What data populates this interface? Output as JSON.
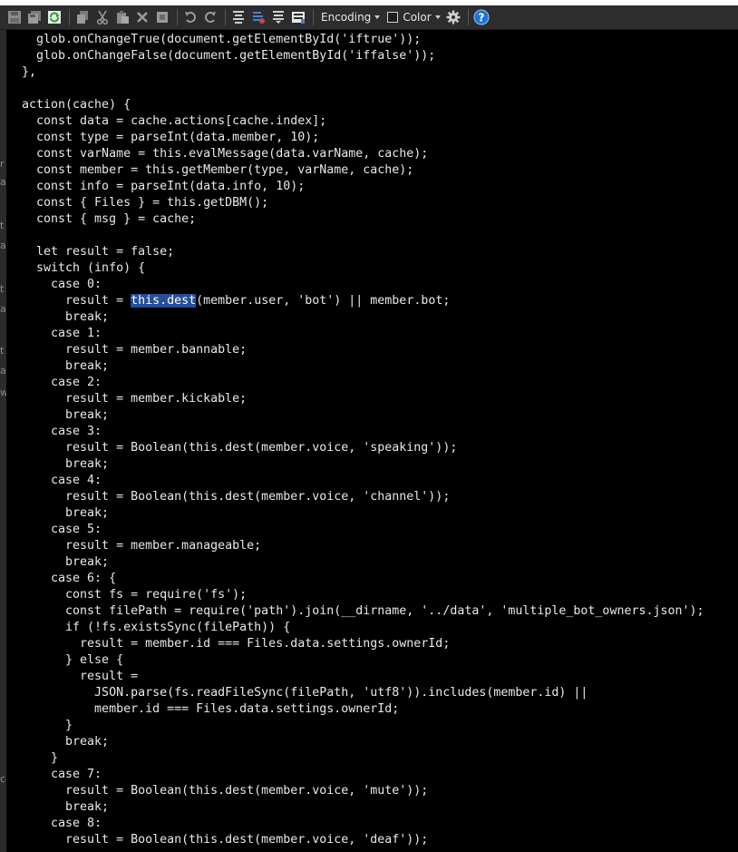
{
  "toolbar": {
    "encoding_label": "Encoding",
    "color_label": "Color",
    "icons": [
      "save-icon",
      "save-all-icon",
      "refresh-icon",
      "copy-icon",
      "cut-icon",
      "paste-icon",
      "delete-icon",
      "stop-icon",
      "undo-icon",
      "redo-icon",
      "compare-icon",
      "compare-alt-icon",
      "compare-next-icon",
      "panel-icon",
      "gear-icon",
      "help-icon"
    ]
  },
  "editor": {
    "selected_text": "this.dest",
    "lines": [
      "  glob.onChangeTrue(document.getElementById('iftrue'));",
      "  glob.onChangeFalse(document.getElementById('iffalse'));",
      "},",
      "",
      "action(cache) {",
      "  const data = cache.actions[cache.index];",
      "  const type = parseInt(data.member, 10);",
      "  const varName = this.evalMessage(data.varName, cache);",
      "  const member = this.getMember(type, varName, cache);",
      "  const info = parseInt(data.info, 10);",
      "  const { Files } = this.getDBM();",
      "  const { msg } = cache;",
      "",
      "  let result = false;",
      "  switch (info) {",
      "    case 0:",
      "      result = this.dest(member.user, 'bot') || member.bot;",
      "      break;",
      "    case 1:",
      "      result = member.bannable;",
      "      break;",
      "    case 2:",
      "      result = member.kickable;",
      "      break;",
      "    case 3:",
      "      result = Boolean(this.dest(member.voice, 'speaking'));",
      "      break;",
      "    case 4:",
      "      result = Boolean(this.dest(member.voice, 'channel'));",
      "      break;",
      "    case 5:",
      "      result = member.manageable;",
      "      break;",
      "    case 6: {",
      "      const fs = require('fs');",
      "      const filePath = require('path').join(__dirname, '../data', 'multiple_bot_owners.json');",
      "      if (!fs.existsSync(filePath)) {",
      "        result = member.id === Files.data.settings.ownerId;",
      "      } else {",
      "        result =",
      "          JSON.parse(fs.readFileSync(filePath, 'utf8')).includes(member.id) ||",
      "          member.id === Files.data.settings.ownerId;",
      "      }",
      "      break;",
      "    }",
      "    case 7:",
      "      result = Boolean(this.dest(member.voice, 'mute'));",
      "      break;",
      "    case 8:",
      "      result = Boolean(this.dest(member.voice, 'deaf'));"
    ]
  },
  "colors": {
    "toolbar_bg": "#2d2d30",
    "editor_bg": "#000000",
    "text": "#e8e8e8",
    "selection": "#264f99",
    "help_blue": "#1e73d6"
  }
}
